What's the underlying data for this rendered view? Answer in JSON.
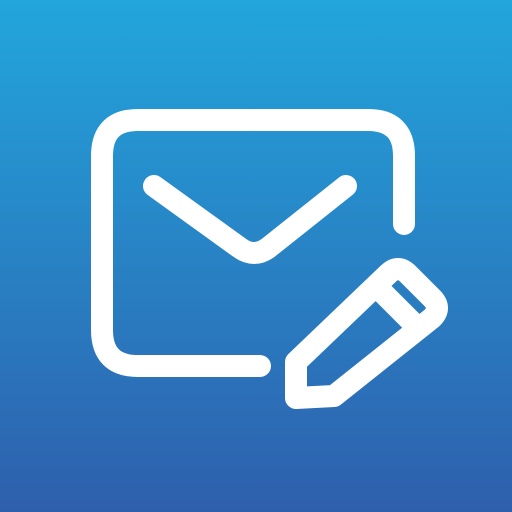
{
  "icon": {
    "glyph": "envelope-with-pencil-icon",
    "gradient": {
      "top": "#22A6DC",
      "bottom": "#2E5FAD"
    },
    "stroke_color": "#FFFFFF"
  }
}
